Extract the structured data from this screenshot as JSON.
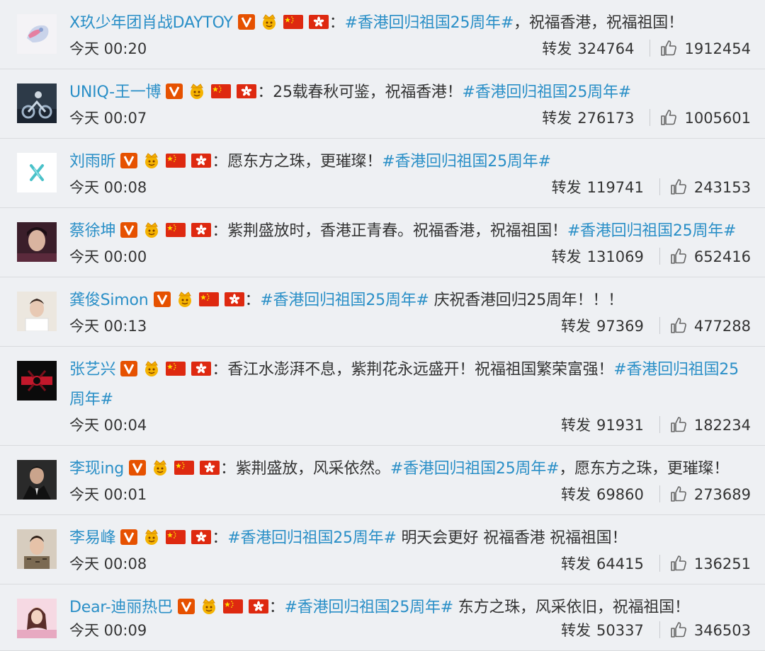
{
  "colors": {
    "link": "#2a8fc7",
    "background": "#eef0f3",
    "verified_badge": "#e65100",
    "crown_badge": "#f5b301",
    "cn_flag": "#de2910",
    "hk_flag": "#de2910"
  },
  "badges": {
    "verified": "verified-v-icon",
    "crown": "crown-fan-icon",
    "cn_flag": "china-flag-icon",
    "hk_flag": "hong-kong-flag-icon"
  },
  "like_icon": "thumbs-up-icon",
  "comments": [
    {
      "username": "X玖少年团肖战DAYTOY",
      "segments": [
        {
          "t": "#香港回归祖国25周年#",
          "h": true
        },
        {
          "t": "，祝福香港，祝福祖国！",
          "h": false
        }
      ],
      "time": "今天 00:20",
      "repost_label": "转发",
      "reposts": "324764",
      "likes": "1912454",
      "avatar": "x-nine-logo"
    },
    {
      "username": "UNIQ-王一博",
      "segments": [
        {
          "t": "25载春秋可鉴，祝福香港！",
          "h": false
        },
        {
          "t": "#香港回归祖国25周年#",
          "h": true
        }
      ],
      "time": "今天 00:07",
      "repost_label": "转发",
      "reposts": "276173",
      "likes": "1005601",
      "avatar": "motorcycle-photo"
    },
    {
      "username": "刘雨昕",
      "segments": [
        {
          "t": "愿东方之珠，更璀璨！",
          "h": false
        },
        {
          "t": "#香港回归祖国25周年#",
          "h": true
        }
      ],
      "time": "今天 00:08",
      "repost_label": "转发",
      "reposts": "119741",
      "likes": "243153",
      "avatar": "x-symbol-logo"
    },
    {
      "username": "蔡徐坤",
      "segments": [
        {
          "t": "紫荆盛放时，香港正青春。祝福香港，祝福祖国！",
          "h": false
        },
        {
          "t": "#香港回归祖国25周年#",
          "h": true
        }
      ],
      "time": "今天 00:00",
      "repost_label": "转发",
      "reposts": "131069",
      "likes": "652416",
      "avatar": "portrait-dark"
    },
    {
      "username": "龚俊Simon",
      "segments": [
        {
          "t": "#香港回归祖国25周年#",
          "h": true
        },
        {
          "t": " 庆祝香港回归25周年！！！",
          "h": false
        }
      ],
      "time": "今天 00:13",
      "repost_label": "转发",
      "reposts": "97369",
      "likes": "477288",
      "avatar": "portrait-light"
    },
    {
      "username": "张艺兴",
      "segments": [
        {
          "t": "香江水澎湃不息，紫荆花永远盛开！祝福祖国繁荣富强！",
          "h": false
        },
        {
          "t": "#香港回归祖国25周年#",
          "h": true
        }
      ],
      "time": "今天 00:04",
      "repost_label": "转发",
      "reposts": "91931",
      "likes": "182234",
      "avatar": "red-black-logo"
    },
    {
      "username": "李现ing",
      "segments": [
        {
          "t": "紫荆盛放，风采依然。",
          "h": false
        },
        {
          "t": "#香港回归祖国25周年#",
          "h": true
        },
        {
          "t": "，愿东方之珠，更璀璨！",
          "h": false
        }
      ],
      "time": "今天 00:01",
      "repost_label": "转发",
      "reposts": "69860",
      "likes": "273689",
      "avatar": "portrait-suit"
    },
    {
      "username": "李易峰",
      "segments": [
        {
          "t": "#香港回归祖国25周年#",
          "h": true
        },
        {
          "t": " 明天会更好 祝福香港 祝福祖国！",
          "h": false
        }
      ],
      "time": "今天 00:08",
      "repost_label": "转发",
      "reposts": "64415",
      "likes": "136251",
      "avatar": "portrait-pattern"
    },
    {
      "username": "Dear-迪丽热巴",
      "segments": [
        {
          "t": "#香港回归祖国25周年#",
          "h": true
        },
        {
          "t": " 东方之珠，风采依旧，祝福祖国！",
          "h": false
        }
      ],
      "time": "今天 00:09",
      "repost_label": "转发",
      "reposts": "50337",
      "likes": "346503",
      "avatar": "portrait-pink"
    }
  ]
}
